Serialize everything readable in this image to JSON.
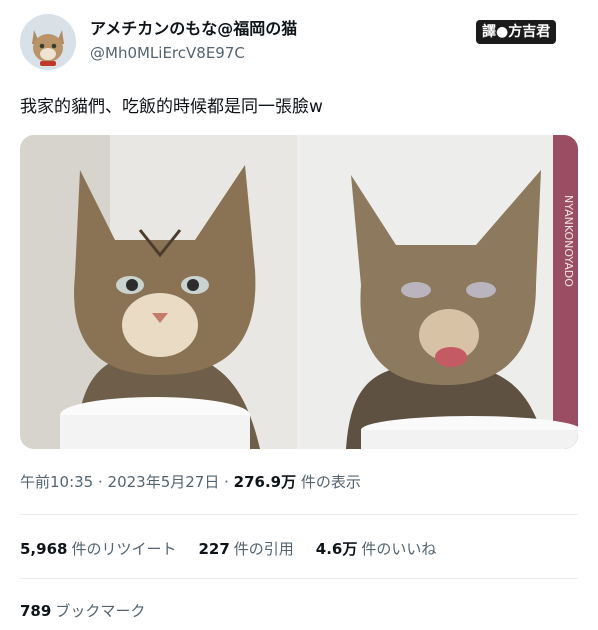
{
  "author": {
    "display_name": "アメチカンのもな@福岡の猫",
    "handle": "@Mh0MLiErcV8E97C"
  },
  "translator_badge": "譯●方吉君",
  "tweet": {
    "text": "我家的貓們、吃飯的時候都是同一張臉w"
  },
  "media": {
    "right_photo_book_text": "NYANKONOYADO"
  },
  "meta": {
    "time": "午前10:35",
    "separator1": " · ",
    "date": "2023年5月27日",
    "separator2": " · ",
    "views_count": "276.9万",
    "views_label": " 件の表示"
  },
  "stats": {
    "retweets_count": "5,968",
    "retweets_label": "件のリツイート",
    "quotes_count": "227",
    "quotes_label": "件の引用",
    "likes_count": "4.6万",
    "likes_label": "件のいいね"
  },
  "bookmarks": {
    "count": "789",
    "label": "ブックマーク"
  }
}
